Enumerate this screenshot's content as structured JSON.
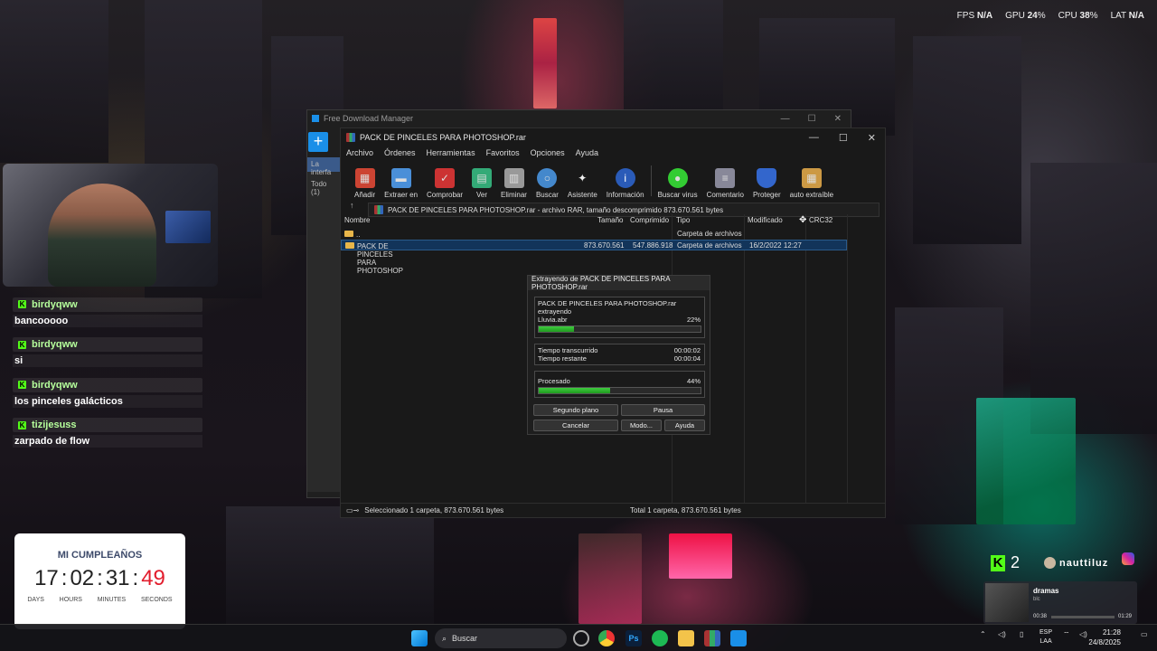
{
  "perf": {
    "fps_label": "FPS",
    "fps": "N/A",
    "gpu_label": "GPU",
    "gpu": "24",
    "cpu_label": "CPU",
    "cpu": "38",
    "lat_label": "LAT",
    "lat": "N/A",
    "pct": "%"
  },
  "chat": [
    {
      "user": "birdyqww",
      "text": "bancooooo"
    },
    {
      "user": "birdyqww",
      "text": "si"
    },
    {
      "user": "birdyqww",
      "text": "los pinceles galácticos"
    },
    {
      "user": "tizijesuss",
      "text": "zarpado de flow"
    }
  ],
  "countdown": {
    "title": "MI CUMPLEAÑOS",
    "days": "17",
    "hours": "02",
    "minutes": "31",
    "seconds": "49",
    "sep": ":",
    "labels": {
      "days": "DAYS",
      "hours": "HOURS",
      "minutes": "MINUTES",
      "seconds": "SECONDS"
    }
  },
  "fdm": {
    "title": "Free Download Manager",
    "add": "+",
    "side1": "La interfa",
    "side2": "Todo (1)"
  },
  "rar": {
    "title": "PACK DE PINCELES PARA PHOTOSHOP.rar",
    "menu": [
      "Archivo",
      "Órdenes",
      "Herramientas",
      "Favoritos",
      "Opciones",
      "Ayuda"
    ],
    "tools": [
      {
        "label": "Añadir",
        "icon": "books-icon",
        "color": "#c43"
      },
      {
        "label": "Extraer en",
        "icon": "folder-extract-icon",
        "color": "#4a8fd8"
      },
      {
        "label": "Comprobar",
        "icon": "clipboard-check-icon",
        "color": "#c33"
      },
      {
        "label": "Ver",
        "icon": "book-icon",
        "color": "#3a7"
      },
      {
        "label": "Eliminar",
        "icon": "trash-icon",
        "color": "#999"
      },
      {
        "label": "Buscar",
        "icon": "magnifier-icon",
        "color": "#48c"
      },
      {
        "label": "Asistente",
        "icon": "wand-icon",
        "color": "#aaa"
      },
      {
        "label": "Información",
        "icon": "info-icon",
        "color": "#2a5bb8"
      },
      {
        "label": "Buscar virus",
        "icon": "virus-scan-icon",
        "color": "#3c3"
      },
      {
        "label": "Comentario",
        "icon": "comment-icon",
        "color": "#889"
      },
      {
        "label": "Proteger",
        "icon": "shield-icon",
        "color": "#36c"
      },
      {
        "label": "auto extraíble",
        "icon": "sfx-icon",
        "color": "#c94"
      }
    ],
    "path": "PACK DE PINCELES PARA PHOTOSHOP.rar - archivo RAR, tamaño descomprimido 873.670.561 bytes",
    "cols": {
      "name": "Nombre",
      "size": "Tamaño",
      "packed": "Comprimido",
      "type": "Tipo",
      "modified": "Modificado",
      "crc": "CRC32"
    },
    "rows": [
      {
        "name": "..",
        "size": "",
        "packed": "",
        "type": "Carpeta de archivos",
        "modified": ""
      },
      {
        "name": "PACK DE PINCELES PARA PHOTOSHOP",
        "size": "873.670.561",
        "packed": "547.886.918",
        "type": "Carpeta de archivos",
        "modified": "16/2/2022 12:27"
      }
    ],
    "status_left": "Seleccionado 1 carpeta, 873.670.561 bytes",
    "status_right": "Total 1 carpeta, 873.670.561 bytes"
  },
  "dialog": {
    "title": "Extrayendo de PACK DE PINCELES PARA PHOTOSHOP.rar",
    "archive": "PACK DE PINCELES PARA PHOTOSHOP.rar",
    "action": "extrayendo",
    "file": "Lluvia.abr",
    "file_pct": "22%",
    "file_progress": 22,
    "elapsed_label": "Tiempo transcurrido",
    "elapsed": "00:00:02",
    "remaining_label": "Tiempo restante",
    "remaining": "00:00:04",
    "processed_label": "Procesado",
    "processed_pct": "44%",
    "processed_progress": 44,
    "buttons": {
      "background": "Segundo plano",
      "pause": "Pausa",
      "cancel": "Cancelar",
      "mode": "Modo...",
      "help": "Ayuda"
    }
  },
  "kick": {
    "count": "2",
    "brand": "nauttiluz"
  },
  "music": {
    "title": "dramas",
    "artist": "blc",
    "elapsed": "00:38",
    "total": "01:29"
  },
  "taskbar": {
    "search": "Buscar",
    "lang1": "ESP",
    "lang2": "LAA",
    "time": "21:28",
    "date": "24/8/2025"
  }
}
